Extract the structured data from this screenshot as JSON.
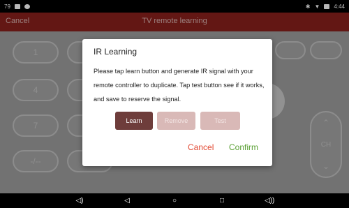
{
  "status": {
    "left_text": "79",
    "right_text": "4:44"
  },
  "appbar": {
    "cancel_label": "Cancel",
    "title": "TV remote learning"
  },
  "remote": {
    "keys": [
      "1",
      "4",
      "7",
      "-/--"
    ],
    "ch_label": "CH"
  },
  "dialog": {
    "title": "IR Learning",
    "body": "Please tap learn button and generate IR signal with your remote controller to duplicate. Tap test button see if it works, and save to reserve the signal.",
    "learn_label": "Learn",
    "remove_label": "Remove",
    "test_label": "Test",
    "cancel_label": "Cancel",
    "confirm_label": "Confirm"
  },
  "colors": {
    "appbar": "#8a201c",
    "learn_button": "#6e3d3b",
    "disabled_button": "#d9b9b7",
    "cancel_text": "#e24a34",
    "confirm_text": "#5aa034"
  }
}
